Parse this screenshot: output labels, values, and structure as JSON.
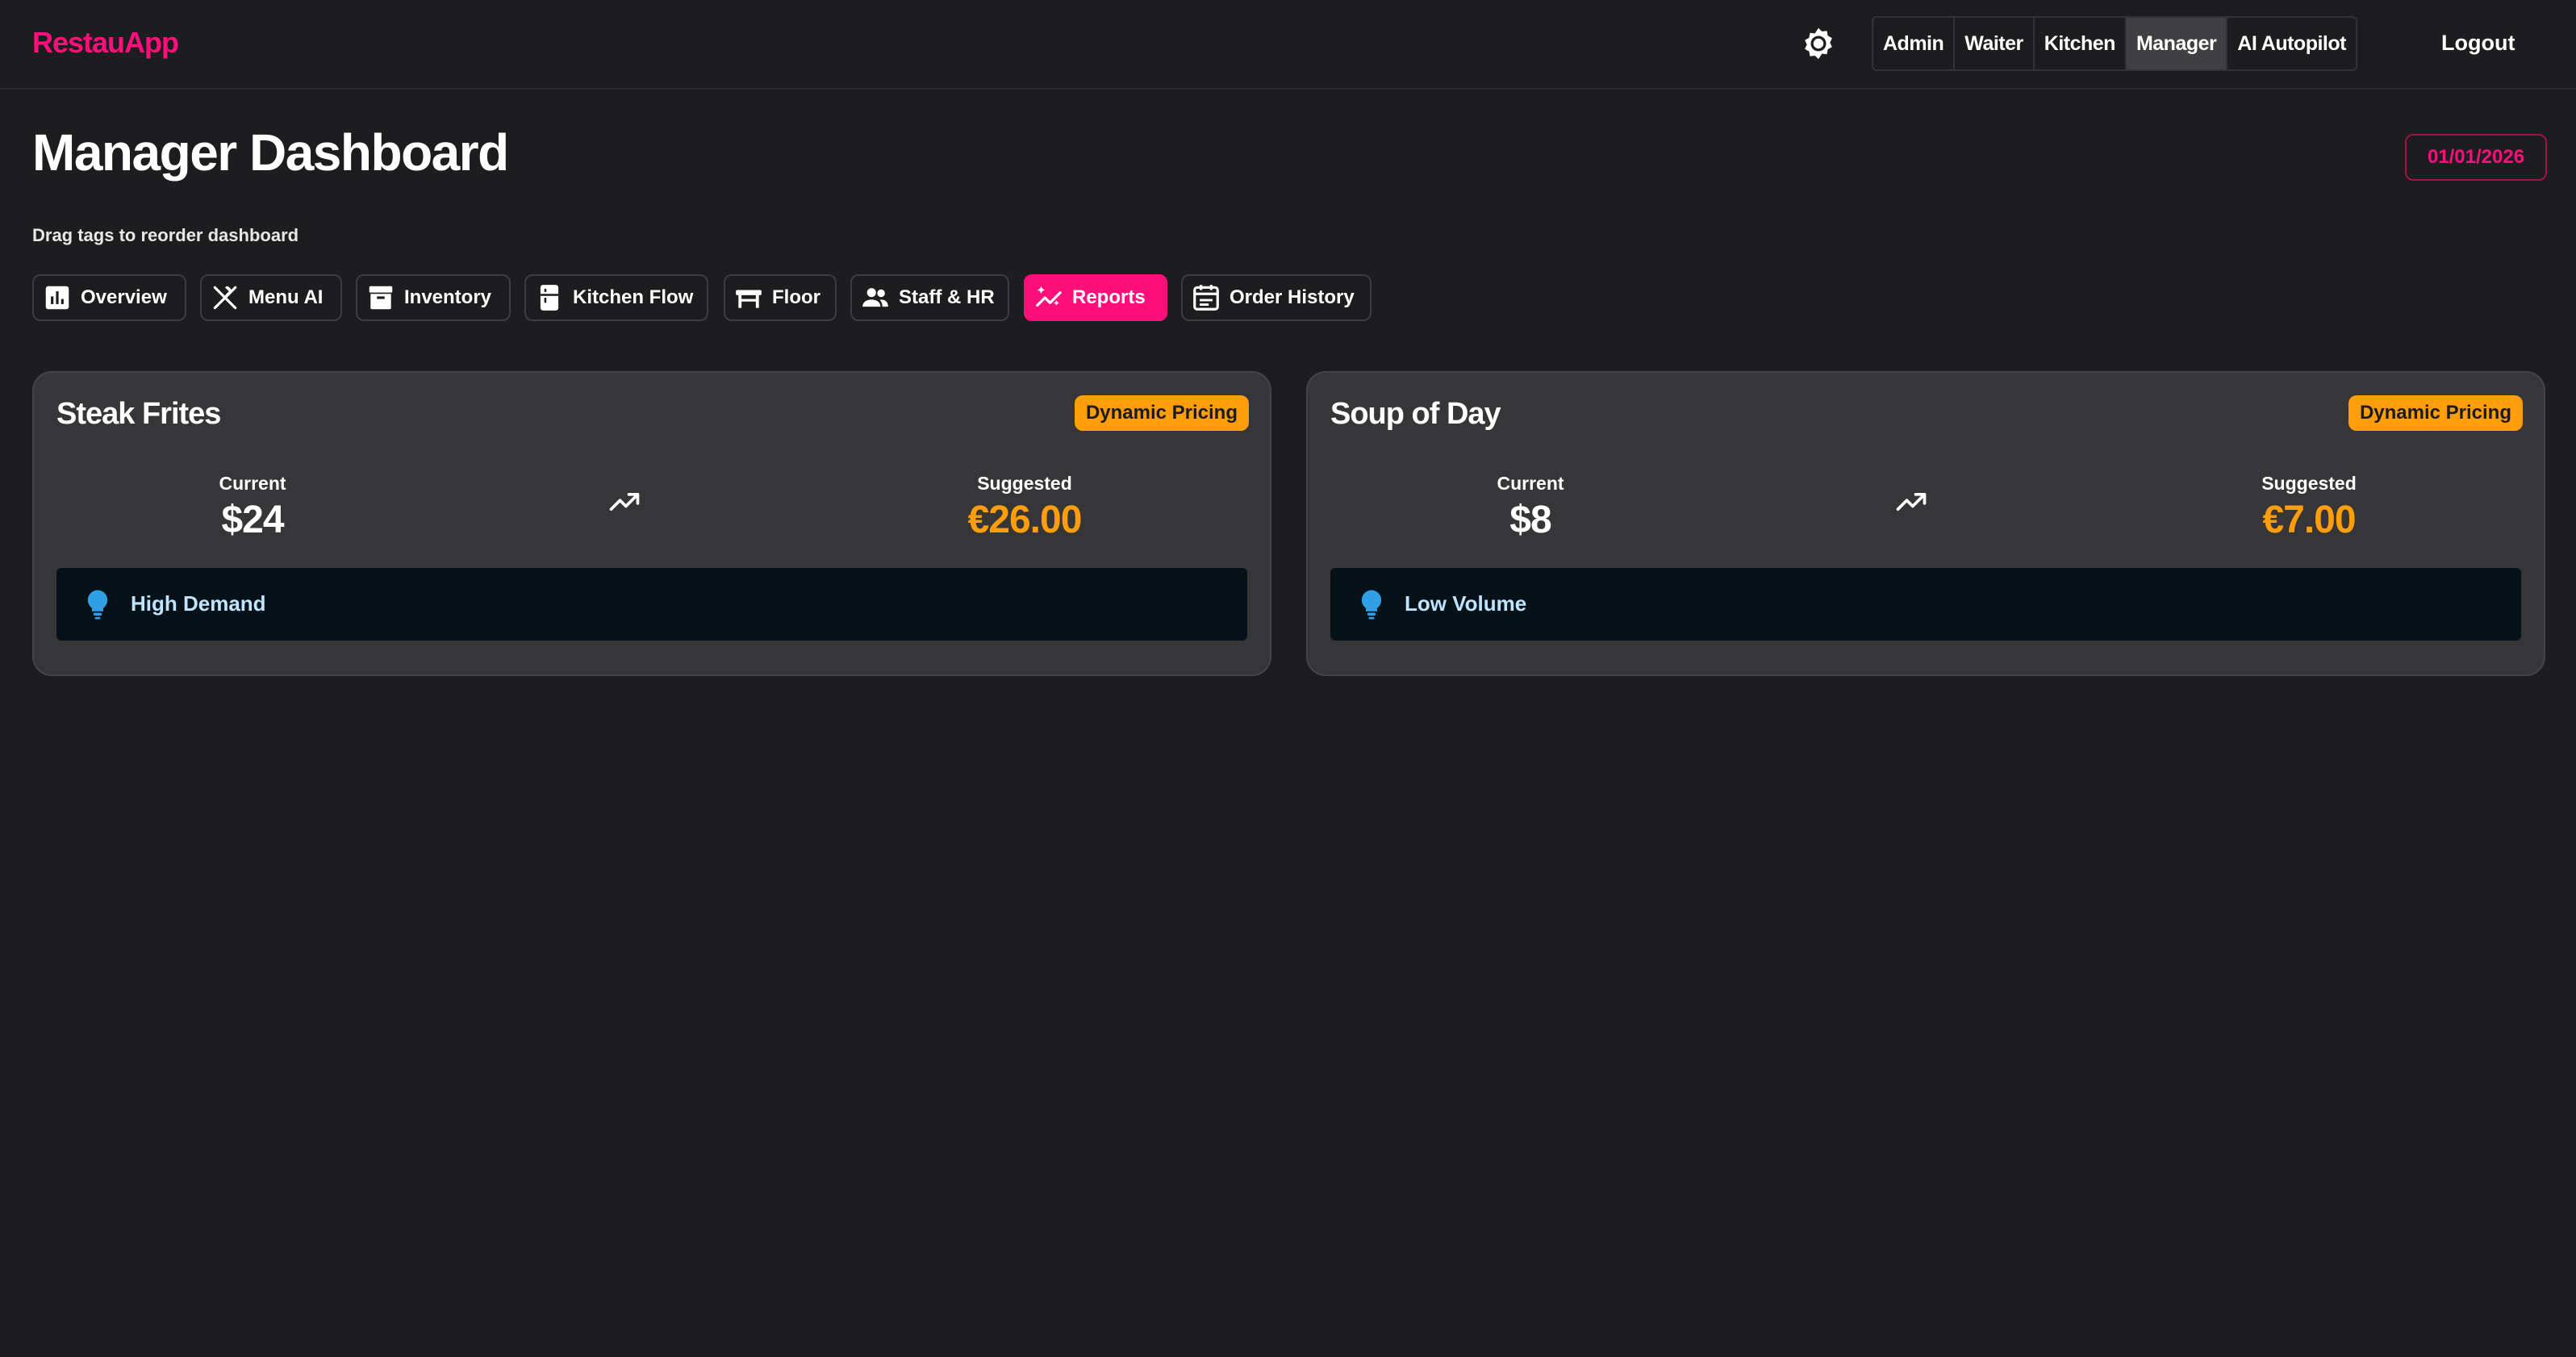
{
  "app": {
    "logo": "RestauApp"
  },
  "header": {
    "theme_icon": "sun-gear-icon",
    "roles": [
      {
        "label": "Admin",
        "active": false
      },
      {
        "label": "Waiter",
        "active": false
      },
      {
        "label": "Kitchen",
        "active": false
      },
      {
        "label": "Manager",
        "active": true
      },
      {
        "label": "AI Autopilot",
        "active": false
      }
    ],
    "logout_label": "Logout"
  },
  "page": {
    "title": "Manager Dashboard",
    "date": "01/01/2026",
    "hint": "Drag tags to reorder dashboard"
  },
  "tabs": [
    {
      "label": "Overview",
      "icon": "bar-chart-icon",
      "active": false
    },
    {
      "label": "Menu AI",
      "icon": "fork-knife-icon",
      "active": false
    },
    {
      "label": "Inventory",
      "icon": "archive-box-icon",
      "active": false
    },
    {
      "label": "Kitchen Flow",
      "icon": "fridge-icon",
      "active": false
    },
    {
      "label": "Floor",
      "icon": "table-icon",
      "active": false
    },
    {
      "label": "Staff & HR",
      "icon": "people-icon",
      "active": false
    },
    {
      "label": "Reports",
      "icon": "sparkle-trend-icon",
      "active": true
    },
    {
      "label": "Order History",
      "icon": "calendar-list-icon",
      "active": false
    }
  ],
  "cards": [
    {
      "name": "Steak Frites",
      "badge": "Dynamic Pricing",
      "current_label": "Current",
      "current_value": "$24",
      "suggested_label": "Suggested",
      "suggested_value": "€26.00",
      "insight": "High Demand"
    },
    {
      "name": "Soup of Day",
      "badge": "Dynamic Pricing",
      "current_label": "Current",
      "current_value": "$8",
      "suggested_label": "Suggested",
      "suggested_value": "€7.00",
      "insight": "Low Volume"
    }
  ],
  "colors": {
    "background": "#1d1d1f",
    "brand": "#ff0f7b",
    "card": "#363638",
    "accent_orange": "#ff9d0a",
    "insight_bg": "#071218",
    "insight_icon": "#2fa0e6"
  }
}
